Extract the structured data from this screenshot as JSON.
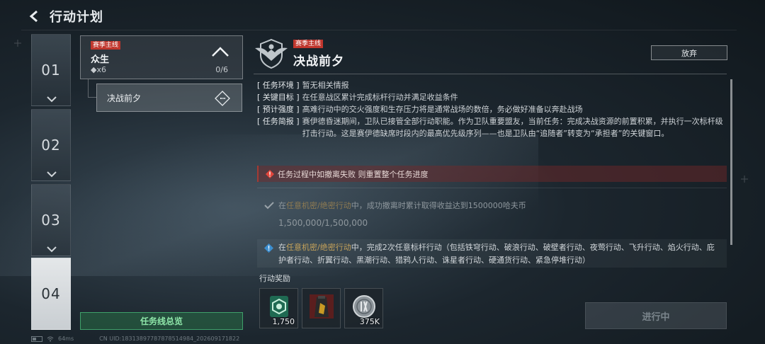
{
  "header": {
    "title": "行动计划"
  },
  "chapters": [
    {
      "label": "01",
      "active": false
    },
    {
      "label": "02",
      "active": false
    },
    {
      "label": "03",
      "active": false
    },
    {
      "label": "04",
      "active": true
    }
  ],
  "quest": {
    "tag": "赛季主线",
    "name": "众生",
    "reward": "◆x6",
    "progress": "0/6",
    "sub_item": "决战前夕"
  },
  "overview_button": "任务线总览",
  "detail": {
    "tag": "赛季主线",
    "title": "决战前夕",
    "abandon_label": "放弃",
    "info": [
      {
        "key": "[ 任务环境 ]",
        "value": "暂无相关情报"
      },
      {
        "key": "[ 关键目标 ]",
        "value": "在任意战区累计完成标杆行动并满足收益条件"
      },
      {
        "key": "[ 预计强度 ]",
        "value": "高难行动中的交火强度和生存压力将是通常战场的数倍，务必做好准备以奔赴战场"
      },
      {
        "key": "[ 任务简报 ]",
        "value": "赛伊德昏迷期间，卫队已接管全部行动职能。作为卫队重要盟友，当前任务：完成决战资源的前置积累，并执行一次标杆级打击行动。这是赛伊德缺席时段内的最高优先级序列——也是卫队由“追随者”转变为“承担者”的关键窗口。"
      }
    ],
    "warning": "任务过程中如撤离失败 则重置整个任务进度",
    "objective1": {
      "pre": "在",
      "highlight": "任意机密/绝密行动",
      "post": "中，成功撤离时累计取得收益达到1500000哈夫币",
      "progress": "1,500,000/1,500,000"
    },
    "objective2": {
      "pre": "在",
      "highlight": "任意机密/绝密行动",
      "post": "中，完成2次任意标杆行动（包括铁穹行动、破浪行动、破壁者行动、夜莺行动、飞升行动、焰火行动、庇护者行动、折翼行动、黑潮行动、猎鸦人行动、诛星者行动、硬通货行动、紧急停堆行动）"
    }
  },
  "rewards": {
    "label": "行动奖励",
    "items": [
      {
        "icon": "green-badge-icon",
        "qty": "1,750"
      },
      {
        "icon": "supply-bag-icon",
        "qty": ""
      },
      {
        "icon": "silver-coin-icon",
        "qty": "375K"
      }
    ]
  },
  "progress_button": "进行中",
  "status": {
    "ping": "64ms",
    "uid": "CN UID:1831389778787851498​4_202609171822"
  },
  "colors": {
    "accent_red": "#c0362d",
    "accent_green": "#3fa06a",
    "highlight_gold": "#c7a35a"
  }
}
